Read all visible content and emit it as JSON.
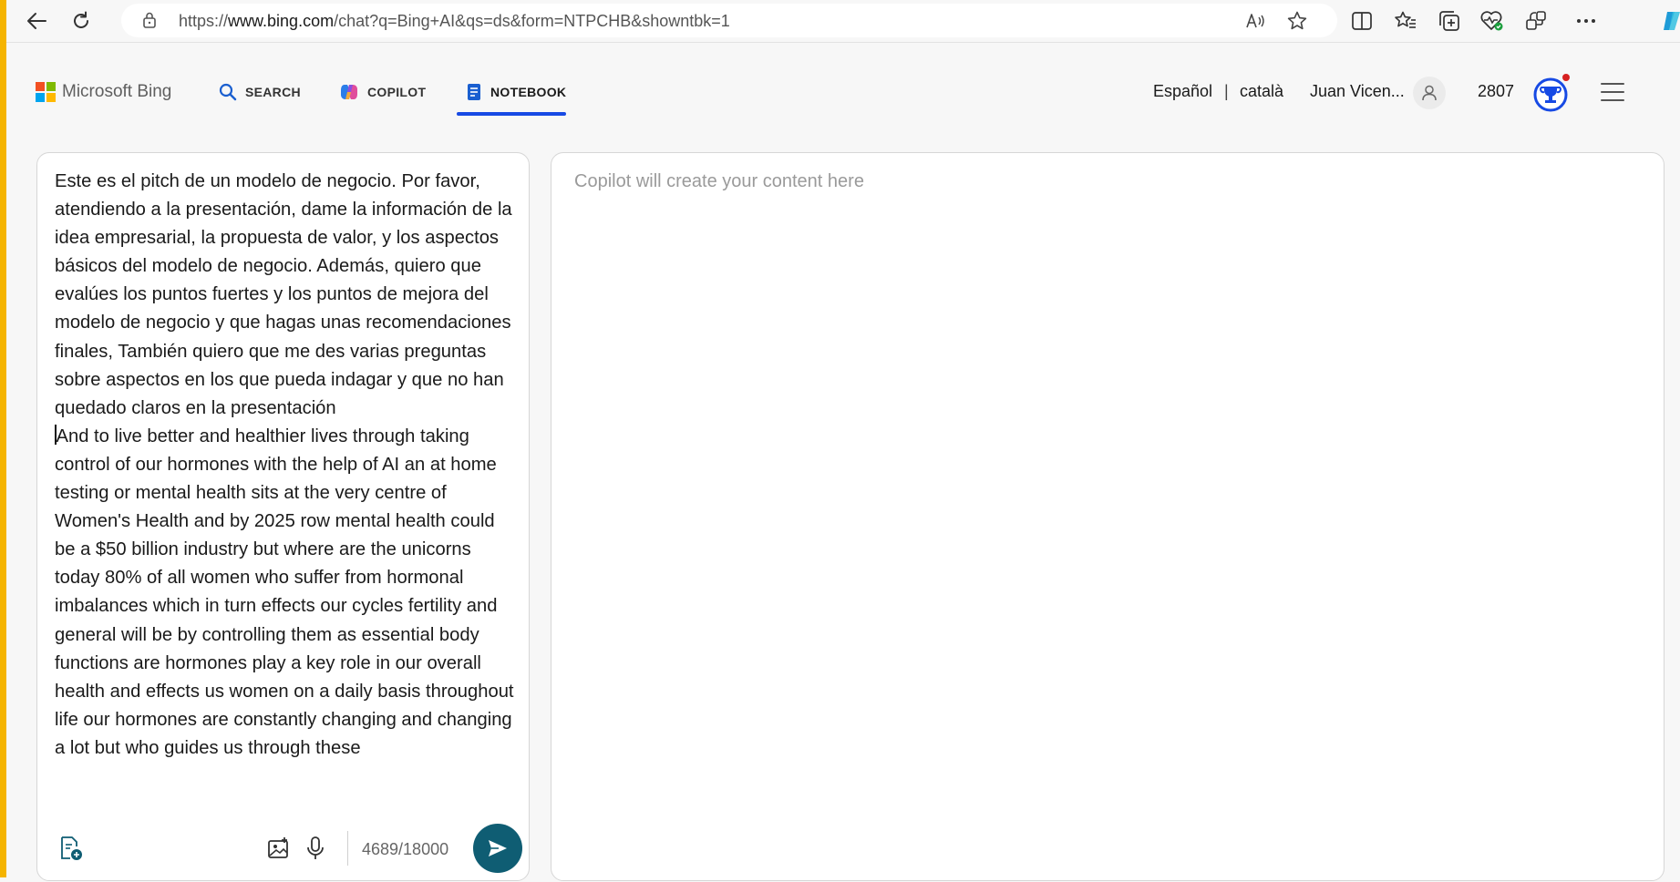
{
  "browser": {
    "url_prefix": "https://",
    "url_domain": "www.bing.com",
    "url_path": "/chat?q=Bing+AI&qs=ds&form=NTPCHB&showntbk=1"
  },
  "header": {
    "brand": "Microsoft Bing",
    "tabs": [
      {
        "label": "SEARCH"
      },
      {
        "label": "COPILOT"
      },
      {
        "label": "NOTEBOOK"
      }
    ],
    "lang_primary": "Español",
    "lang_separator": "|",
    "lang_secondary": "català",
    "user_name": "Juan Vicen...",
    "points": "2807"
  },
  "composer": {
    "prompt_paragraph_1": "Este es el pitch de un modelo de negocio. Por favor, atendiendo a la presentación, dame la información de la idea empresarial, la propuesta de valor, y los aspectos básicos del modelo de negocio. Además, quiero que evalúes los puntos fuertes y los puntos de mejora del modelo de negocio y que hagas unas recomendaciones finales, También quiero que me des varias preguntas sobre aspectos en los que pueda indagar y que no han quedado claros en la presentación",
    "prompt_paragraph_2": "And to live better and healthier lives through taking control of our hormones with the help of AI an at home testing or mental health sits at the very centre of Women's Health and by 2025 row mental health could be a $50 billion industry but where are the unicorns today 80% of all women who suffer from hormonal imbalances which in turn effects our cycles fertility and general will be by controlling them as essential body functions are hormones play a key role in our overall health and effects us women on a daily basis throughout life our hormones are constantly changing and changing a lot but who guides us through these",
    "char_count": "4689/18000"
  },
  "output": {
    "placeholder": "Copilot will create your content here"
  },
  "colors": {
    "accent_bar": "#f5b400",
    "tab_underline": "#174ae4",
    "send_button": "#0f5d73"
  }
}
